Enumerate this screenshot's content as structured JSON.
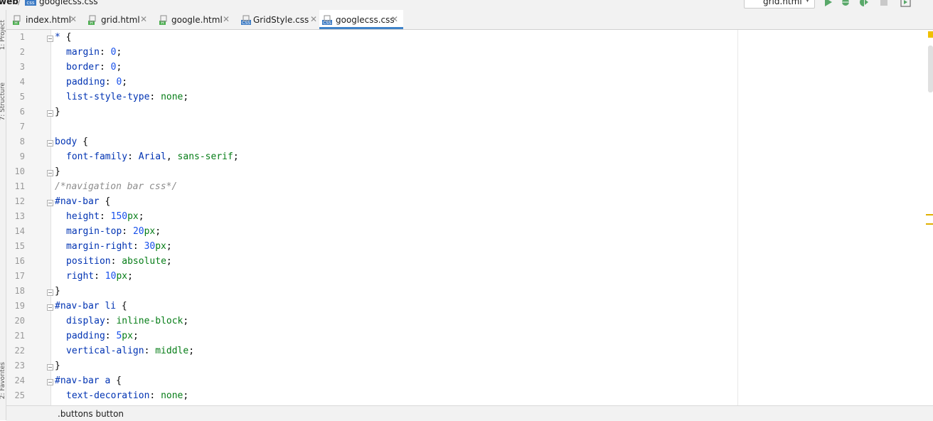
{
  "breadcrumb": {
    "root": "web",
    "separator": "/",
    "file": "googlecss.css",
    "file_icon_text": "css"
  },
  "run_config": {
    "label": "grid.html",
    "arrow": "▼"
  },
  "toolbar_icons": [
    "run-icon",
    "debug-icon",
    "coverage-icon",
    "stop-icon",
    "frame-icon"
  ],
  "left_strip": {
    "project_label": "1: Project",
    "structure_label": "7: Structure",
    "favorites_label": "2: Favorites"
  },
  "tabs": [
    {
      "label": "index.html",
      "icon": "H",
      "close": "✕"
    },
    {
      "label": "grid.html",
      "icon": "H",
      "close": "✕"
    },
    {
      "label": "google.html",
      "icon": "H",
      "close": "✕"
    },
    {
      "label": "GridStyle.css",
      "icon": "CSS",
      "close": "✕"
    },
    {
      "label": "googlecss.css",
      "icon": "CSS",
      "close": "✕",
      "active": true
    }
  ],
  "colors": {
    "accent": "#4083c9",
    "selector": "#0033b3",
    "value": "#067d17",
    "number": "#1750eb",
    "comment": "#8c8c8c",
    "html_icon": "#4caf50",
    "css_icon": "#3b7ac4"
  },
  "code_lines": [
    {
      "n": "1",
      "t": [
        [
          "sel",
          "*"
        ],
        [
          "punct",
          " {"
        ]
      ],
      "indent": 0,
      "fold": true
    },
    {
      "n": "2",
      "t": [
        [
          "prop",
          "margin"
        ],
        [
          "punct",
          ": "
        ],
        [
          "num",
          "0"
        ],
        [
          "punct",
          ";"
        ]
      ],
      "indent": 1
    },
    {
      "n": "3",
      "t": [
        [
          "prop",
          "border"
        ],
        [
          "punct",
          ": "
        ],
        [
          "num",
          "0"
        ],
        [
          "punct",
          ";"
        ]
      ],
      "indent": 1
    },
    {
      "n": "4",
      "t": [
        [
          "prop",
          "padding"
        ],
        [
          "punct",
          ": "
        ],
        [
          "num",
          "0"
        ],
        [
          "punct",
          ";"
        ]
      ],
      "indent": 1
    },
    {
      "n": "5",
      "t": [
        [
          "prop",
          "list-style-type"
        ],
        [
          "punct",
          ": "
        ],
        [
          "val",
          "none"
        ],
        [
          "punct",
          ";"
        ]
      ],
      "indent": 1
    },
    {
      "n": "6",
      "t": [
        [
          "punct",
          "}"
        ]
      ],
      "indent": 0,
      "fold": true
    },
    {
      "n": "7",
      "t": [],
      "indent": 0
    },
    {
      "n": "8",
      "t": [
        [
          "sel",
          "body"
        ],
        [
          "punct",
          " {"
        ]
      ],
      "indent": 0,
      "fold": true
    },
    {
      "n": "9",
      "t": [
        [
          "prop",
          "font-family"
        ],
        [
          "punct",
          ": "
        ],
        [
          "prop",
          "Arial"
        ],
        [
          "punct",
          ", "
        ],
        [
          "val",
          "sans-serif"
        ],
        [
          "punct",
          ";"
        ]
      ],
      "indent": 1
    },
    {
      "n": "10",
      "t": [
        [
          "punct",
          "}"
        ]
      ],
      "indent": 0,
      "fold": true
    },
    {
      "n": "11",
      "t": [
        [
          "cmt",
          "/*navigation bar css*/"
        ]
      ],
      "indent": 0
    },
    {
      "n": "12",
      "t": [
        [
          "sel",
          "#nav-bar"
        ],
        [
          "punct",
          " {"
        ]
      ],
      "indent": 0,
      "fold": true
    },
    {
      "n": "13",
      "t": [
        [
          "prop",
          "height"
        ],
        [
          "punct",
          ": "
        ],
        [
          "num",
          "150"
        ],
        [
          "unit",
          "px"
        ],
        [
          "punct",
          ";"
        ]
      ],
      "indent": 1
    },
    {
      "n": "14",
      "t": [
        [
          "prop",
          "margin-top"
        ],
        [
          "punct",
          ": "
        ],
        [
          "num",
          "20"
        ],
        [
          "unit",
          "px"
        ],
        [
          "punct",
          ";"
        ]
      ],
      "indent": 1
    },
    {
      "n": "15",
      "t": [
        [
          "prop",
          "margin-right"
        ],
        [
          "punct",
          ": "
        ],
        [
          "num",
          "30"
        ],
        [
          "unit",
          "px"
        ],
        [
          "punct",
          ";"
        ]
      ],
      "indent": 1
    },
    {
      "n": "16",
      "t": [
        [
          "prop",
          "position"
        ],
        [
          "punct",
          ": "
        ],
        [
          "val",
          "absolute"
        ],
        [
          "punct",
          ";"
        ]
      ],
      "indent": 1
    },
    {
      "n": "17",
      "t": [
        [
          "prop",
          "right"
        ],
        [
          "punct",
          ": "
        ],
        [
          "num",
          "10"
        ],
        [
          "unit",
          "px"
        ],
        [
          "punct",
          ";"
        ]
      ],
      "indent": 1
    },
    {
      "n": "18",
      "t": [
        [
          "punct",
          "}"
        ]
      ],
      "indent": 0,
      "fold": true
    },
    {
      "n": "19",
      "t": [
        [
          "sel",
          "#nav-bar li"
        ],
        [
          "punct",
          " {"
        ]
      ],
      "indent": 0,
      "fold": true
    },
    {
      "n": "20",
      "t": [
        [
          "prop",
          "display"
        ],
        [
          "punct",
          ": "
        ],
        [
          "val",
          "inline-block"
        ],
        [
          "punct",
          ";"
        ]
      ],
      "indent": 1
    },
    {
      "n": "21",
      "t": [
        [
          "prop",
          "padding"
        ],
        [
          "punct",
          ": "
        ],
        [
          "num",
          "5"
        ],
        [
          "unit",
          "px"
        ],
        [
          "punct",
          ";"
        ]
      ],
      "indent": 1
    },
    {
      "n": "22",
      "t": [
        [
          "prop",
          "vertical-align"
        ],
        [
          "punct",
          ": "
        ],
        [
          "val",
          "middle"
        ],
        [
          "punct",
          ";"
        ]
      ],
      "indent": 1
    },
    {
      "n": "23",
      "t": [
        [
          "punct",
          "}"
        ]
      ],
      "indent": 0,
      "fold": true
    },
    {
      "n": "24",
      "t": [
        [
          "sel",
          "#nav-bar a"
        ],
        [
          "punct",
          " {"
        ]
      ],
      "indent": 0,
      "fold": true
    },
    {
      "n": "25",
      "t": [
        [
          "prop",
          "text-decoration"
        ],
        [
          "punct",
          ": "
        ],
        [
          "val",
          "none"
        ],
        [
          "punct",
          ";"
        ]
      ],
      "indent": 1
    }
  ],
  "status": {
    "breadcrumb": ".buttons button"
  }
}
